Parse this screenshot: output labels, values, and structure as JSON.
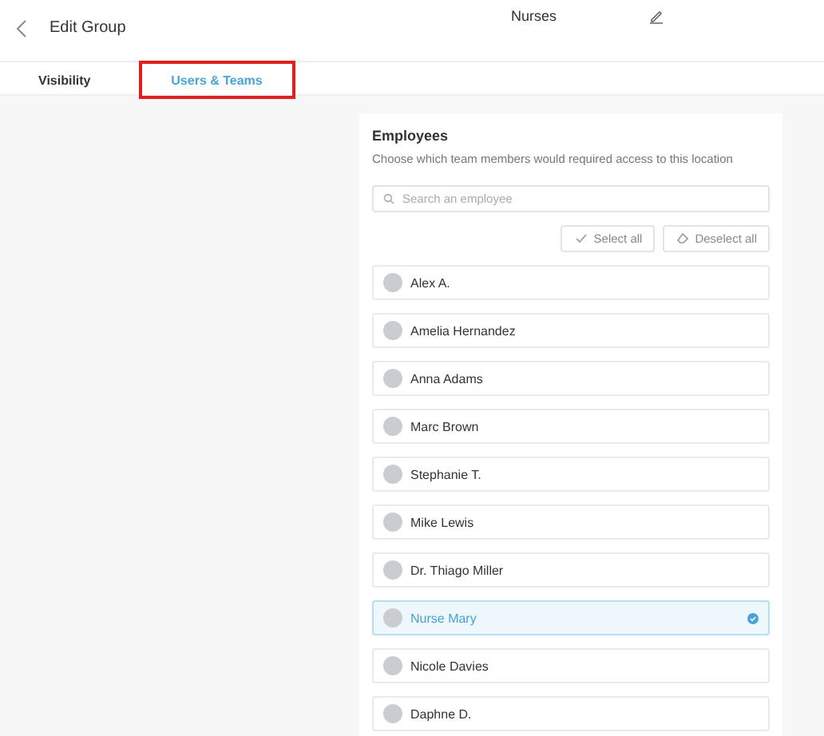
{
  "header": {
    "title": "Edit Group",
    "group_name": "Nurses"
  },
  "tabs": [
    {
      "label": "Visibility",
      "selected": false
    },
    {
      "label": "Users & Teams",
      "selected": true
    }
  ],
  "employees": {
    "title": "Employees",
    "subtitle": "Choose which team members would required access to this location",
    "search": {
      "placeholder": "Search an employee"
    },
    "buttons": [
      "Select all",
      "Deselect all"
    ],
    "items": [
      {
        "name": "Alex A.",
        "selected": false
      },
      {
        "name": "Amelia Hernandez",
        "selected": false
      },
      {
        "name": "Anna Adams",
        "selected": false
      },
      {
        "name": "Marc Brown",
        "selected": false
      },
      {
        "name": "Stephanie T.",
        "selected": false
      },
      {
        "name": "Mike Lewis",
        "selected": false
      },
      {
        "name": "Dr. Thiago Miller",
        "selected": false
      },
      {
        "name": "Nurse Mary",
        "selected": true
      },
      {
        "name": "Nicole Davies",
        "selected": false
      },
      {
        "name": "Daphne D.",
        "selected": false
      }
    ]
  }
}
